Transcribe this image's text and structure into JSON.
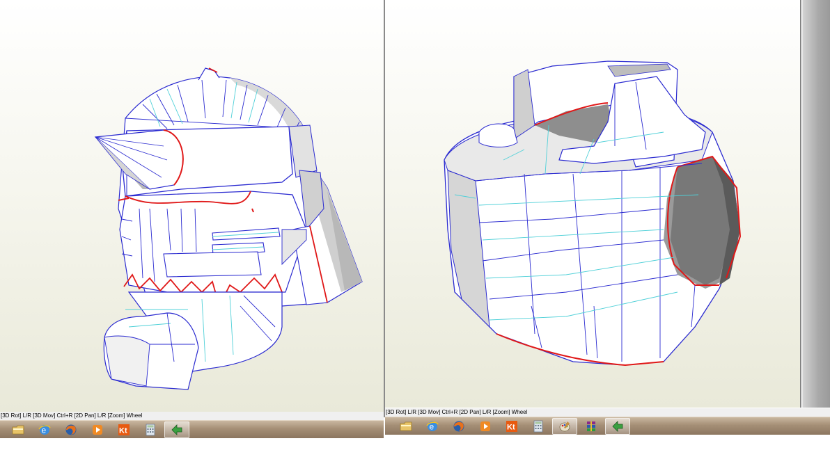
{
  "left_view": {
    "status_text": "[3D Rot] L/R [3D Mov] Ctrl+R [2D Pan] L/R [Zoom] Wheel",
    "taskbar_icons": [
      "folder-icon",
      "internet-explorer-icon",
      "firefox-icon",
      "media-player-icon",
      "kt-app-icon",
      "calculator-icon",
      "pepakura-icon"
    ],
    "active_icon": "pepakura-icon"
  },
  "right_view": {
    "status_text": "[3D Rot] L/R [3D Mov] Ctrl+R [2D Pan] L/R [Zoom] Wheel",
    "taskbar_icons": [
      "folder-icon",
      "internet-explorer-icon",
      "firefox-icon",
      "media-player-icon",
      "kt-app-icon",
      "calculator-icon",
      "paint-icon",
      "winrar-icon",
      "pepakura-icon"
    ],
    "active_icon": "pepakura-icon",
    "kt_label": "Kt"
  },
  "colors": {
    "model_fill": "#ffffff",
    "edge_blue": "#2a2ad0",
    "edge_cyan": "#4fd0d8",
    "edge_red": "#e01818",
    "shade": "#bdbdbd"
  }
}
